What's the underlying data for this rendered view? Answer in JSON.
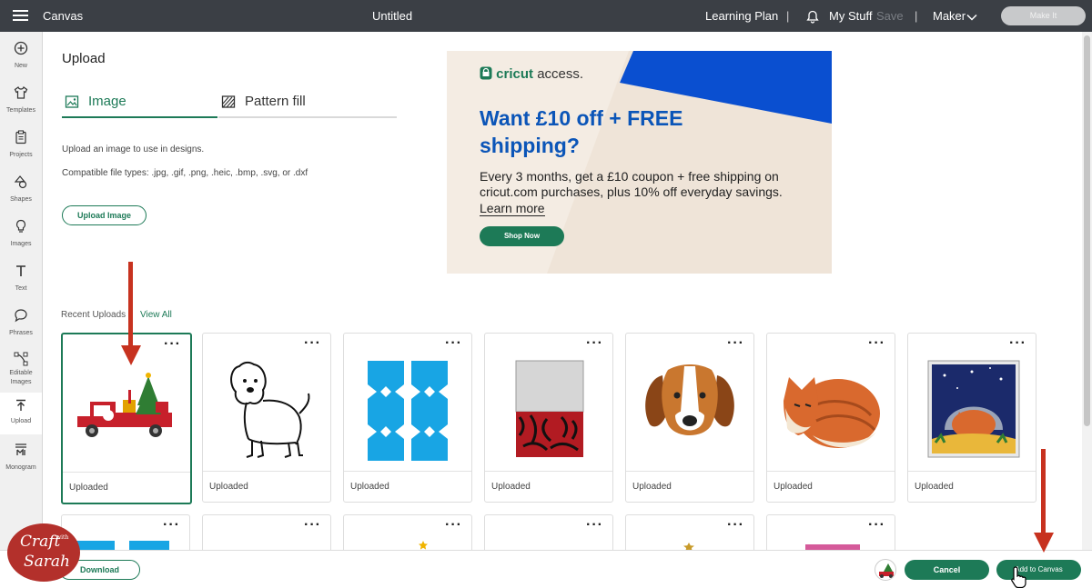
{
  "topbar": {
    "app_name": "Canvas",
    "doc_title": "Untitled",
    "learning_plan": "Learning Plan",
    "separator": "|",
    "my_stuff": "My Stuff",
    "save": "Save",
    "machine": "Maker",
    "make_it": "Make It"
  },
  "sidebar": {
    "items": [
      {
        "label": "New",
        "icon": "plus-circle-icon"
      },
      {
        "label": "Templates",
        "icon": "shirt-icon"
      },
      {
        "label": "Projects",
        "icon": "clipboard-icon"
      },
      {
        "label": "Shapes",
        "icon": "shapes-icon"
      },
      {
        "label": "Images",
        "icon": "bulb-icon"
      },
      {
        "label": "Text",
        "icon": "text-icon"
      },
      {
        "label": "Phrases",
        "icon": "speech-bubble-icon"
      },
      {
        "label": "Editable",
        "label2": "Images",
        "icon": "edit-nodes-icon"
      },
      {
        "label": "Upload",
        "icon": "upload-icon"
      },
      {
        "label": "Monogram",
        "icon": "monogram-icon"
      }
    ]
  },
  "upload": {
    "title": "Upload",
    "tabs": [
      {
        "label": "Image",
        "active": true
      },
      {
        "label": "Pattern fill",
        "active": false
      }
    ],
    "description": "Upload an image to use in designs.",
    "file_types": "Compatible file types: .jpg, .gif, .png, .heic, .bmp, .svg, or .dxf",
    "upload_button": "Upload Image"
  },
  "ad": {
    "brand_name": "cricut",
    "brand_suffix": "access.",
    "headline": "Want £10 off + FREE shipping?",
    "body": "Every 3 months, get a £10 coupon + free shipping on cricut.com purchases, plus 10% off everyday savings.",
    "link": "Learn more",
    "cta": "Shop Now",
    "colors": {
      "accent_blue": "#0b55b8",
      "accent_green": "#1d7a57",
      "background": "#f4ece3"
    }
  },
  "recent": {
    "label": "Recent Uploads",
    "view_all": "View All",
    "more_menu": "···",
    "items": [
      {
        "caption": "Uploaded",
        "image": "red-christmas-truck",
        "selected": true
      },
      {
        "caption": "Uploaded",
        "image": "shaggy-dog-outline",
        "selected": false
      },
      {
        "caption": "Uploaded",
        "image": "blue-cracker-template",
        "selected": false
      },
      {
        "caption": "Uploaded",
        "image": "just-for-you-tag",
        "selected": false
      },
      {
        "caption": "Uploaded",
        "image": "beagle-face",
        "selected": false
      },
      {
        "caption": "Uploaded",
        "image": "sleeping-fox",
        "selected": false
      },
      {
        "caption": "Uploaded",
        "image": "fox-night-scene",
        "selected": false
      }
    ]
  },
  "bottombar": {
    "download": "Download",
    "cancel": "Cancel",
    "add_to_canvas": "Add to Canvas"
  },
  "watermark": {
    "line1": "Craft",
    "line2": "with",
    "line3": "Sarah"
  }
}
